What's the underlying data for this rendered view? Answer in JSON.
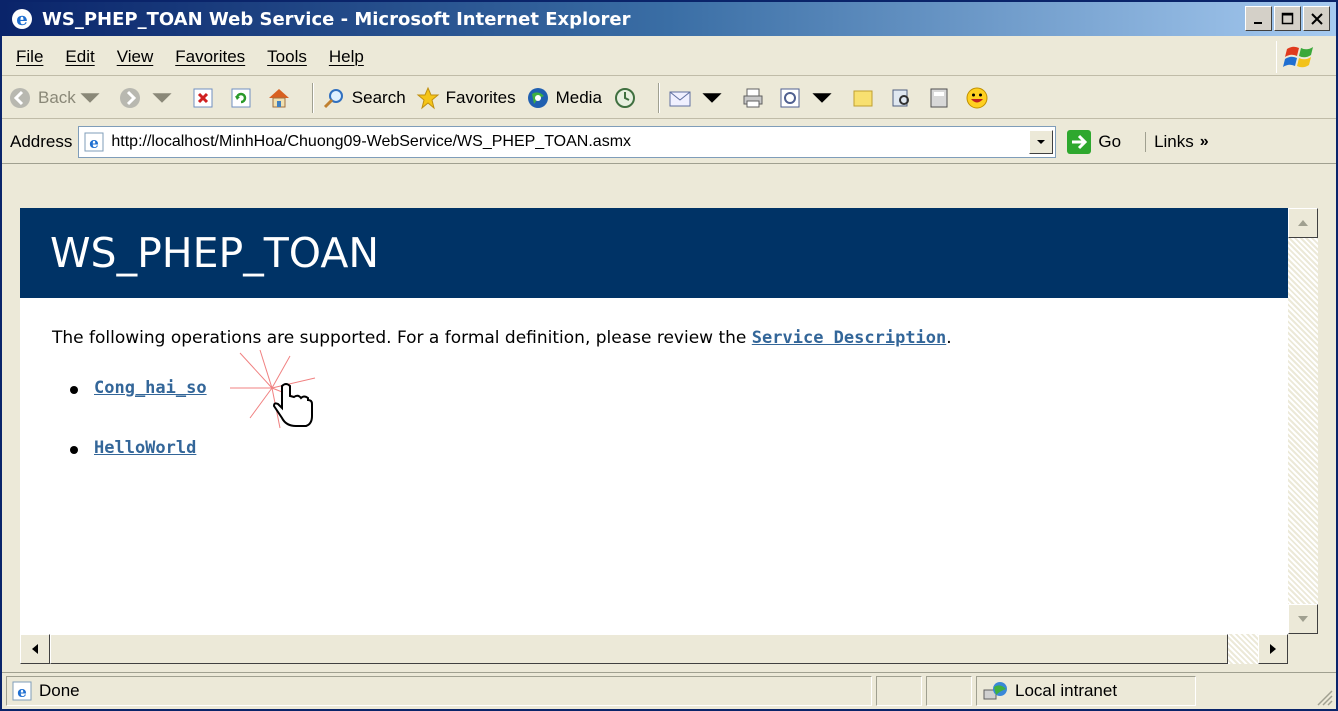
{
  "window": {
    "title": "WS_PHEP_TOAN Web Service - Microsoft Internet Explorer"
  },
  "menu": {
    "items": [
      "File",
      "Edit",
      "View",
      "Favorites",
      "Tools",
      "Help"
    ]
  },
  "toolbar": {
    "back_label": "Back",
    "search_label": "Search",
    "favorites_label": "Favorites",
    "media_label": "Media"
  },
  "address": {
    "label": "Address",
    "url": "http://localhost/MinhHoa/Chuong09-WebService/WS_PHEP_TOAN.asmx",
    "go_label": "Go",
    "links_label": "Links"
  },
  "page": {
    "heading": "WS_PHEP_TOAN",
    "intro_text": "The following operations are supported. For a formal definition, please review the ",
    "service_description_link": "Service Description",
    "intro_end": ".",
    "operations": [
      "Cong_hai_so",
      "HelloWorld"
    ]
  },
  "status": {
    "text": "Done",
    "zone": "Local intranet"
  },
  "colors": {
    "header_bg": "#003366",
    "link": "#336699",
    "titlebar": "#0a246a"
  }
}
